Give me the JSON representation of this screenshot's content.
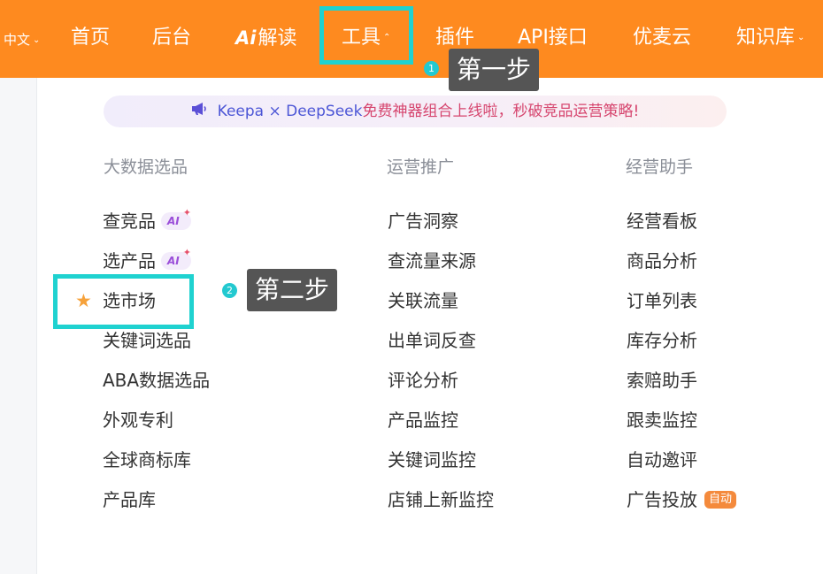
{
  "nav": {
    "language": "中文",
    "items": {
      "home": "首页",
      "backend": "后台",
      "ai_mark": "Ai",
      "ai_read": "解读",
      "tools": "工具",
      "plugins": "插件",
      "api": "API接口",
      "cloud": "优麦云",
      "knowledge": "知识库"
    },
    "background_color": "#fe8a1f"
  },
  "banner": {
    "text_a": "Keepa × DeepSeek",
    "text_b": "免费神器组合上线啦，秒破竞品运营策略!"
  },
  "columns": {
    "big_data": {
      "title": "大数据选品",
      "items": [
        "查竞品",
        "选产品",
        "选市场",
        "关键词选品",
        "ABA数据选品",
        "外观专利",
        "全球商标库",
        "产品库"
      ]
    },
    "operations": {
      "title": "运营推广",
      "items": [
        "广告洞察",
        "查流量来源",
        "关联流量",
        "出单词反查",
        "评论分析",
        "产品监控",
        "关键词监控",
        "店铺上新监控"
      ]
    },
    "assistant": {
      "title": "经营助手",
      "items": [
        "经营看板",
        "商品分析",
        "订单列表",
        "库存分析",
        "索赔助手",
        "跟卖监控",
        "自动邀评",
        "广告投放"
      ]
    }
  },
  "badges": {
    "ai": "AI",
    "auto": "自动"
  },
  "annotations": {
    "step1_number": "1",
    "step1_label": "第一步",
    "step2_number": "2",
    "step2_label": "第二步",
    "highlight_color": "#1fd2d0"
  },
  "icons": [
    "chevron-down-icon",
    "chevron-up-icon",
    "megaphone-icon",
    "star-icon",
    "sparkle-icon"
  ]
}
